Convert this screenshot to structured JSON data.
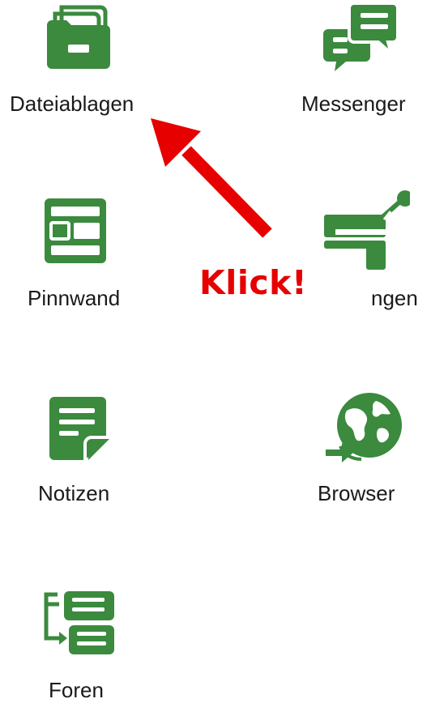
{
  "theme": {
    "icon_color": "#3b8a3e",
    "annotation_color": "#e60000"
  },
  "apps": {
    "dateiablagen": {
      "label": "Dateiablagen",
      "icon": "folder-icon"
    },
    "messenger": {
      "label": "Messenger",
      "icon": "chat-bubbles-icon"
    },
    "pinnwand": {
      "label": "Pinnwand",
      "icon": "board-icon"
    },
    "umfragen": {
      "label": "ngen",
      "icon": "poll-icon"
    },
    "notizen": {
      "label": "Notizen",
      "icon": "note-icon"
    },
    "browser": {
      "label": "Browser",
      "icon": "globe-icon"
    },
    "foren": {
      "label": "Foren",
      "icon": "forum-icon"
    }
  },
  "annotation": {
    "callout_text": "Klick!",
    "pointer": "arrow-pointing-to-dateiablagen"
  }
}
